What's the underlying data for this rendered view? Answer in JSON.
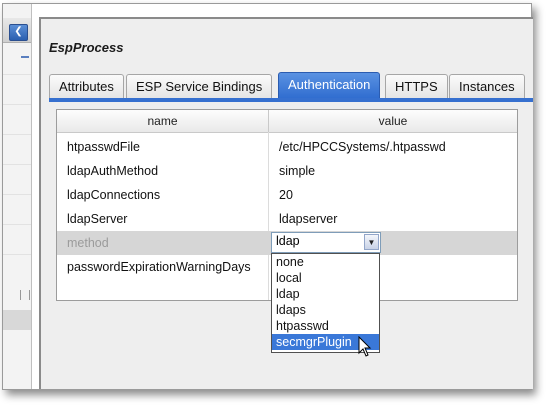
{
  "sidebar": {
    "collapse_icon": "chevron-left-icon"
  },
  "title": "EspProcess",
  "tabs": [
    {
      "label": "Attributes",
      "active": false
    },
    {
      "label": "ESP Service Bindings",
      "active": false
    },
    {
      "label": "Authentication",
      "active": true
    },
    {
      "label": "HTTPS",
      "active": false
    },
    {
      "label": "Instances",
      "active": false
    }
  ],
  "grid": {
    "columns": [
      "name",
      "value"
    ],
    "rows": [
      {
        "name": "htpasswdFile",
        "value": "/etc/HPCCSystems/.htpasswd"
      },
      {
        "name": "ldapAuthMethod",
        "value": "simple"
      },
      {
        "name": "ldapConnections",
        "value": "20"
      },
      {
        "name": "ldapServer",
        "value": "ldapserver"
      },
      {
        "name": "method",
        "value": "ldap"
      },
      {
        "name": "passwordExpirationWarningDays",
        "value": ""
      }
    ]
  },
  "editor": {
    "selected": "ldap",
    "options": [
      "none",
      "local",
      "ldap",
      "ldaps",
      "htpasswd",
      "secmgrPlugin"
    ],
    "highlighted": "secmgrPlugin"
  },
  "colors": {
    "accent": "#3670cf",
    "highlight": "#3a78d8"
  }
}
